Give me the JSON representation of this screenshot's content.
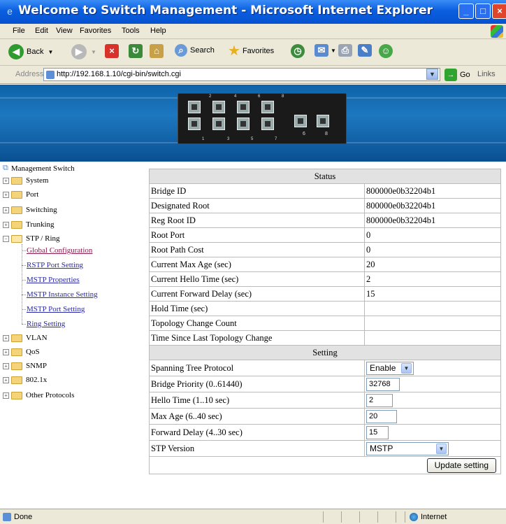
{
  "window": {
    "title": "Welcome to Switch Management - Microsoft Internet Explorer"
  },
  "menu": [
    "File",
    "Edit",
    "View",
    "Favorites",
    "Tools",
    "Help"
  ],
  "toolbar": {
    "back": "Back",
    "search": "Search",
    "favorites": "Favorites"
  },
  "address": {
    "label": "Address",
    "url": "http://192.168.1.10/cgi-bin/switch.cgi",
    "go": "Go",
    "links": "Links"
  },
  "banner": {
    "port_labels": [
      "2",
      "4",
      "6",
      "8",
      "1",
      "3",
      "5",
      "7",
      "6",
      "8"
    ]
  },
  "sidebar": {
    "root": "Management Switch",
    "items": [
      {
        "label": "System"
      },
      {
        "label": "Port"
      },
      {
        "label": "Switching"
      },
      {
        "label": "Trunking"
      },
      {
        "label": "STP / Ring"
      }
    ],
    "stp_children": [
      "Global Configuration",
      "RSTP Port Setting",
      "MSTP Properties",
      "MSTP Instance Setting",
      "MSTP Port Setting",
      "Ring Setting"
    ],
    "items_after": [
      {
        "label": "VLAN"
      },
      {
        "label": "QoS"
      },
      {
        "label": "SNMP"
      },
      {
        "label": "802.1x"
      },
      {
        "label": "Other Protocols"
      }
    ]
  },
  "status": {
    "header": "Status",
    "rows": [
      {
        "label": "Bridge ID",
        "value": "800000e0b32204b1"
      },
      {
        "label": "Designated Root",
        "value": "800000e0b32204b1"
      },
      {
        "label": "Reg Root ID",
        "value": "800000e0b32204b1"
      },
      {
        "label": "Root Port",
        "value": "0"
      },
      {
        "label": "Root Path Cost",
        "value": "0"
      },
      {
        "label": "Current Max Age (sec)",
        "value": "20"
      },
      {
        "label": "Current Hello Time (sec)",
        "value": "2"
      },
      {
        "label": "Current Forward Delay (sec)",
        "value": "15"
      },
      {
        "label": "Hold Time (sec)",
        "value": ""
      },
      {
        "label": "Topology Change Count",
        "value": ""
      },
      {
        "label": "Time Since Last Topology Change",
        "value": ""
      }
    ]
  },
  "setting": {
    "header": "Setting",
    "stp_label": "Spanning Tree Protocol",
    "stp_value": "Enable",
    "priority_label": "Bridge Priority (0..61440)",
    "priority_value": "32768",
    "hello_label": "Hello Time (1..10 sec)",
    "hello_value": "2",
    "maxage_label": "Max Age (6..40 sec)",
    "maxage_value": "20",
    "fwd_label": "Forward Delay (4..30 sec)",
    "fwd_value": "15",
    "version_label": "STP Version",
    "version_value": "MSTP",
    "update_button": "Update setting"
  },
  "statusbar": {
    "left": "Done",
    "zone": "Internet"
  }
}
